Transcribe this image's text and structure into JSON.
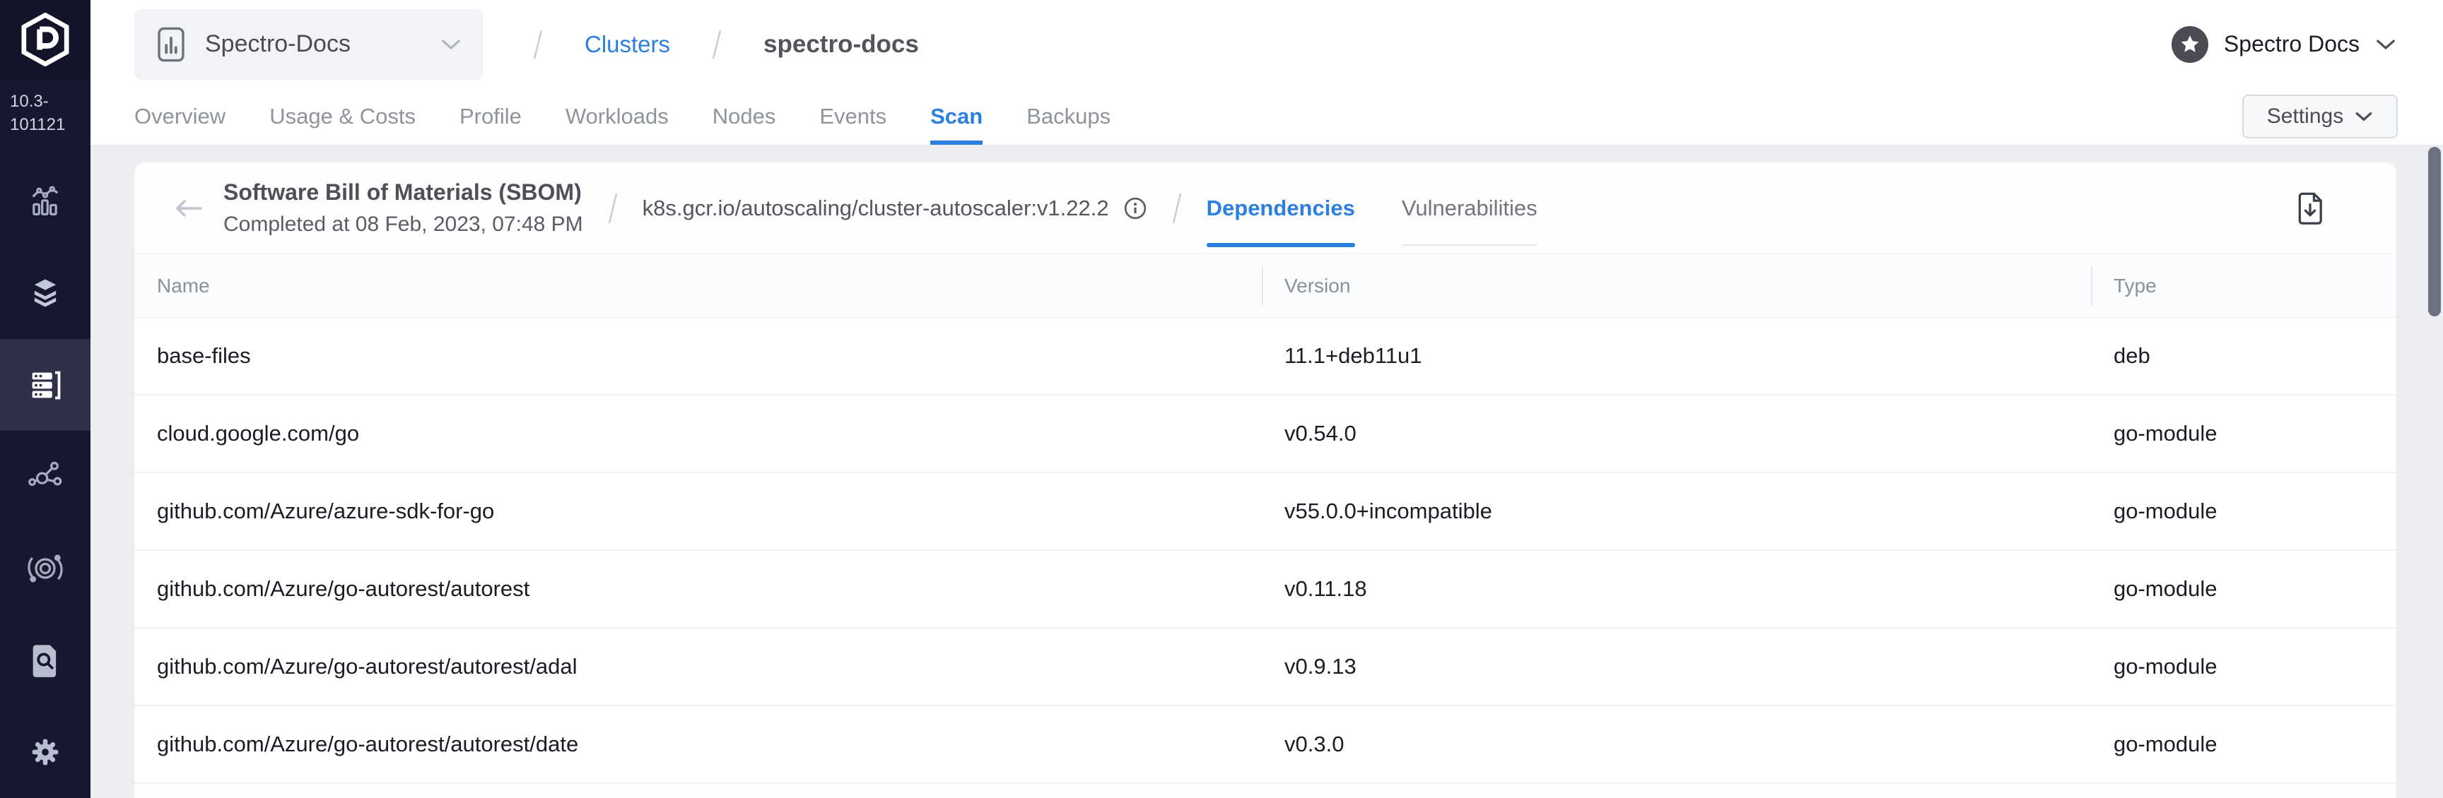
{
  "colors": {
    "accent_blue": "#2b7fe0",
    "sidebar_bg": "#17172f",
    "page_bg": "#eceef2"
  },
  "sidebar": {
    "version_line1": "10.3-",
    "version_line2": "101121"
  },
  "header": {
    "project": "Spectro-Docs",
    "breadcrumb_root": "Clusters",
    "breadcrumb_current": "spectro-docs",
    "account": "Spectro Docs"
  },
  "cluster_tabs": {
    "items": [
      "Overview",
      "Usage & Costs",
      "Profile",
      "Workloads",
      "Nodes",
      "Events",
      "Scan",
      "Backups"
    ],
    "active": "Scan",
    "settings": "Settings"
  },
  "scan": {
    "title": "Software Bill of Materials (SBOM)",
    "completed_at": "Completed at 08 Feb, 2023, 07:48 PM",
    "image": "k8s.gcr.io/autoscaling/cluster-autoscaler:v1.22.2",
    "tabs": [
      "Dependencies",
      "Vulnerabilities"
    ],
    "active_tab": "Dependencies"
  },
  "table": {
    "columns": [
      "Name",
      "Version",
      "Type"
    ],
    "rows": [
      {
        "name": "base-files",
        "version": "11.1+deb11u1",
        "type": "deb"
      },
      {
        "name": "cloud.google.com/go",
        "version": "v0.54.0",
        "type": "go-module"
      },
      {
        "name": "github.com/Azure/azure-sdk-for-go",
        "version": "v55.0.0+incompatible",
        "type": "go-module"
      },
      {
        "name": "github.com/Azure/go-autorest/autorest",
        "version": "v0.11.18",
        "type": "go-module"
      },
      {
        "name": "github.com/Azure/go-autorest/autorest/adal",
        "version": "v0.9.13",
        "type": "go-module"
      },
      {
        "name": "github.com/Azure/go-autorest/autorest/date",
        "version": "v0.3.0",
        "type": "go-module"
      }
    ]
  },
  "icons": [
    "palette-logo",
    "bar-chart",
    "layers",
    "clusters",
    "network",
    "orbit",
    "doc-search",
    "gear",
    "star",
    "chevron-down",
    "slash",
    "info",
    "file-download",
    "back-arrow"
  ]
}
